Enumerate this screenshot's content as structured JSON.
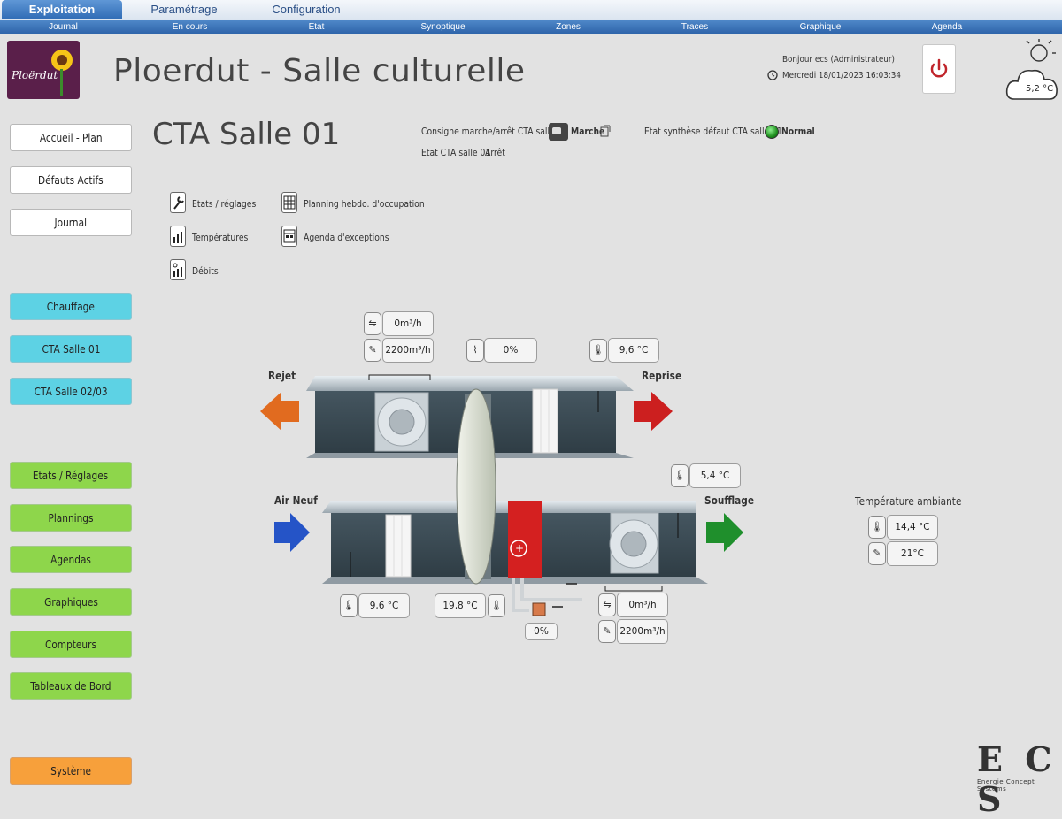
{
  "top_tabs": [
    "Exploitation",
    "Paramétrage",
    "Configuration"
  ],
  "sub_menu": [
    "Journal",
    "En cours",
    "Etat",
    "Synoptique",
    "Zones",
    "Traces",
    "Graphique",
    "Agenda"
  ],
  "header": {
    "logo_text": "Ploërdut",
    "site_title": "Ploerdut - Salle culturelle",
    "user_greeting": "Bonjour ecs (Administrateur)",
    "datetime": "Mercredi 18/01/2023 16:03:34",
    "outside_temp": "5,2 °C"
  },
  "nav": {
    "primary": [
      "Accueil - Plan",
      "Défauts Actifs",
      "Journal"
    ],
    "equipment": [
      "Chauffage",
      "CTA  Salle 01",
      "CTA  Salle 02/03"
    ],
    "functions": [
      "Etats / Réglages",
      "Plannings",
      "Agendas",
      "Graphiques",
      "Compteurs",
      "Tableaux de Bord"
    ],
    "system": "Système"
  },
  "section": {
    "title": "CTA Salle 01",
    "consigne_label": "Consigne marche/arrêt CTA salle 01",
    "consigne_value": "Marche",
    "etat_label": "Etat CTA salle 01",
    "etat_value": "Arrêt",
    "defaut_label": "Etat synthèse défaut CTA salle 01",
    "defaut_value": "Normal",
    "defaut_color": "#2fae2f"
  },
  "links": {
    "etats": "Etats / réglages",
    "temperatures": "Températures",
    "debits": "Débits",
    "planning": "Planning hebdo. d'occupation",
    "agenda": "Agenda d'exceptions"
  },
  "diagram": {
    "rejet": "Rejet",
    "reprise": "Reprise",
    "air_neuf": "Air Neuf",
    "soufflage": "Soufflage",
    "extract_flow": "0m³/h",
    "extract_flow_setpoint": "2200m³/h",
    "recovery_pct": "0%",
    "reprise_temp": "9,6 °C",
    "soufflage_temp": "5,4 °C",
    "air_neuf_temp": "9,6 °C",
    "after_recovery_temp": "19,8 °C",
    "valve_pct": "0%",
    "supply_flow": "0m³/h",
    "supply_flow_setpoint": "2200m³/h",
    "ambient_label": "Température ambiante",
    "ambient_temp": "14,4 °C",
    "ambient_setpoint": "21°C"
  },
  "brand": {
    "letters": "E C S",
    "tagline": "Energie Concept Systems"
  },
  "colors": {
    "tab_active": "#2f6bb5",
    "nav_cyan": "#5dd2e4",
    "nav_green": "#8ed64b",
    "nav_orange": "#f7a03b",
    "heater_red": "#d42020"
  }
}
